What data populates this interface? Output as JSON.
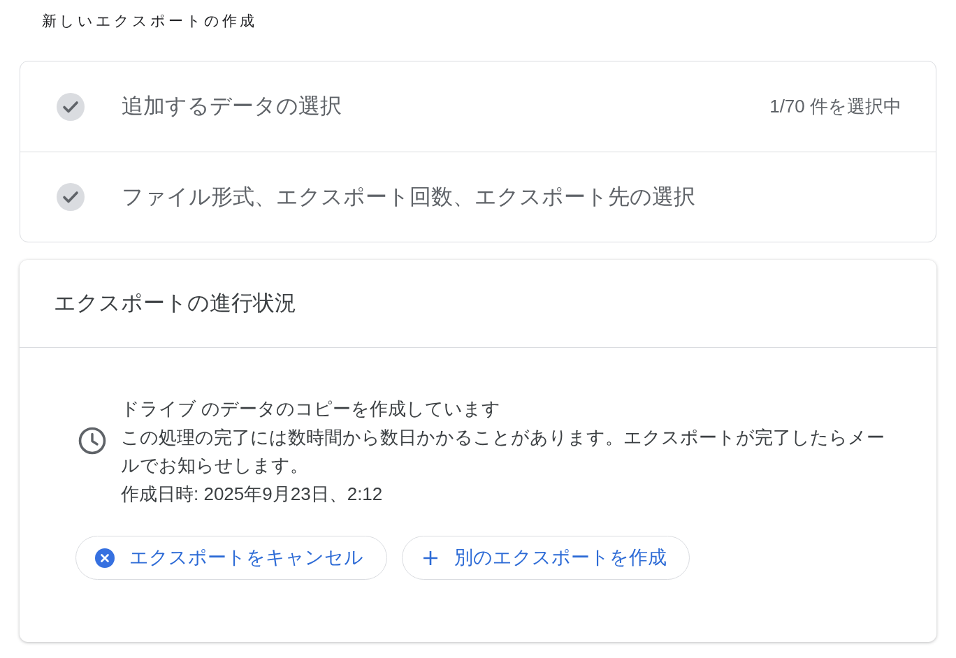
{
  "page_title": "新しいエクスポートの作成",
  "steps": [
    {
      "label": "追加するデータの選択",
      "checked": true,
      "summary": "1/70 件を選択中"
    },
    {
      "label": "ファイル形式、エクスポート回数、エクスポート先の選択",
      "checked": true
    }
  ],
  "progress": {
    "title": "エクスポートの進行状況",
    "status": "ドライブ のデータのコピーを作成しています",
    "message": "この処理の完了には数時間から数日かかることがあります。エクスポートが完了したらメールでお知らせします。",
    "created": "作成日時: 2025年9月23日、2:12",
    "buttons": [
      {
        "kind": "cancel",
        "label": "エクスポートをキャンセル"
      },
      {
        "kind": "create",
        "label": "別のエクスポートを作成"
      }
    ]
  }
}
